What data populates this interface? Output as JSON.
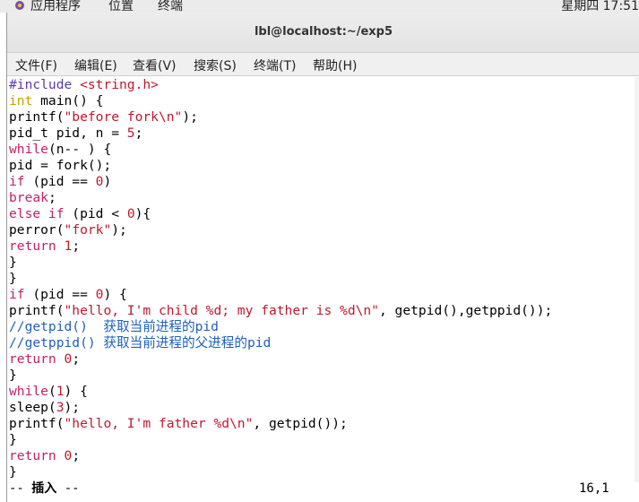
{
  "topbar": {
    "apps_label": "应用程序",
    "places_label": "位置",
    "terminal_label": "终端",
    "clock": "星期四 17:51"
  },
  "window": {
    "title": "lbl@localhost:~/exp5"
  },
  "menu": [
    {
      "label": "文件(F)"
    },
    {
      "label": "编辑(E)"
    },
    {
      "label": "查看(V)"
    },
    {
      "label": "搜索(S)"
    },
    {
      "label": "终端(T)"
    },
    {
      "label": "帮助(H)"
    }
  ],
  "colors": {
    "preproc": "#5a3aa8",
    "keyword": "#c8a000",
    "control": "#c22068",
    "string": "#c0182c",
    "number": "#c0182c",
    "comment": "#2060b8",
    "default": "#000000"
  },
  "code": [
    [
      [
        "#include ",
        "preproc"
      ],
      [
        "<string.h>",
        "string"
      ]
    ],
    [
      [
        "int",
        "keyword"
      ],
      [
        " main() {",
        "default"
      ]
    ],
    [
      [
        "printf(",
        "default"
      ],
      [
        "\"before fork\\n\"",
        "string"
      ],
      [
        ");",
        "default"
      ]
    ],
    [
      [
        "pid_t pid, n = ",
        "default"
      ],
      [
        "5",
        "number"
      ],
      [
        ";",
        "default"
      ]
    ],
    [
      [
        "while",
        "control"
      ],
      [
        "(n-- ) {",
        "default"
      ]
    ],
    [
      [
        "pid = fork();",
        "default"
      ]
    ],
    [
      [
        "if",
        "control"
      ],
      [
        " (pid == ",
        "default"
      ],
      [
        "0",
        "number"
      ],
      [
        ")",
        "default"
      ]
    ],
    [
      [
        "break",
        "control"
      ],
      [
        ";",
        "default"
      ]
    ],
    [
      [
        "else if",
        "control"
      ],
      [
        " (pid < ",
        "default"
      ],
      [
        "0",
        "number"
      ],
      [
        "){",
        "default"
      ]
    ],
    [
      [
        "perror(",
        "default"
      ],
      [
        "\"fork\"",
        "string"
      ],
      [
        ");",
        "default"
      ]
    ],
    [
      [
        "return",
        "control"
      ],
      [
        " ",
        "default"
      ],
      [
        "1",
        "number"
      ],
      [
        ";",
        "default"
      ]
    ],
    [
      [
        "}",
        "default"
      ]
    ],
    [
      [
        "}",
        "default"
      ]
    ],
    [
      [
        "if",
        "control"
      ],
      [
        " (pid == ",
        "default"
      ],
      [
        "0",
        "number"
      ],
      [
        ") {",
        "default"
      ]
    ],
    [
      [
        "printf(",
        "default"
      ],
      [
        "\"hello, I'm child %d; my father is %d\\n\"",
        "string"
      ],
      [
        ", getpid(),getppid());",
        "default"
      ]
    ],
    [
      [
        "//getpid()  获取当前进程的pid",
        "comment"
      ]
    ],
    [
      [
        "//getppid() 获取当前进程的父进程的pid",
        "comment"
      ]
    ],
    [
      [
        "return",
        "control"
      ],
      [
        " ",
        "default"
      ],
      [
        "0",
        "number"
      ],
      [
        ";",
        "default"
      ]
    ],
    [
      [
        "}",
        "default"
      ]
    ],
    [
      [
        "while",
        "control"
      ],
      [
        "(",
        "default"
      ],
      [
        "1",
        "number"
      ],
      [
        ") {",
        "default"
      ]
    ],
    [
      [
        "sleep(",
        "default"
      ],
      [
        "3",
        "number"
      ],
      [
        ");",
        "default"
      ]
    ],
    [
      [
        "printf(",
        "default"
      ],
      [
        "\"hello, I'm father %d\\n\"",
        "string"
      ],
      [
        ", getpid());",
        "default"
      ]
    ],
    [
      [
        "}",
        "default"
      ]
    ],
    [
      [
        "return",
        "control"
      ],
      [
        " ",
        "default"
      ],
      [
        "0",
        "number"
      ],
      [
        ";",
        "default"
      ]
    ],
    [
      [
        "}",
        "default"
      ]
    ]
  ],
  "status": {
    "mode_prefix": "-- ",
    "mode": "插入",
    "mode_suffix": " --",
    "cursor": "16,1"
  }
}
